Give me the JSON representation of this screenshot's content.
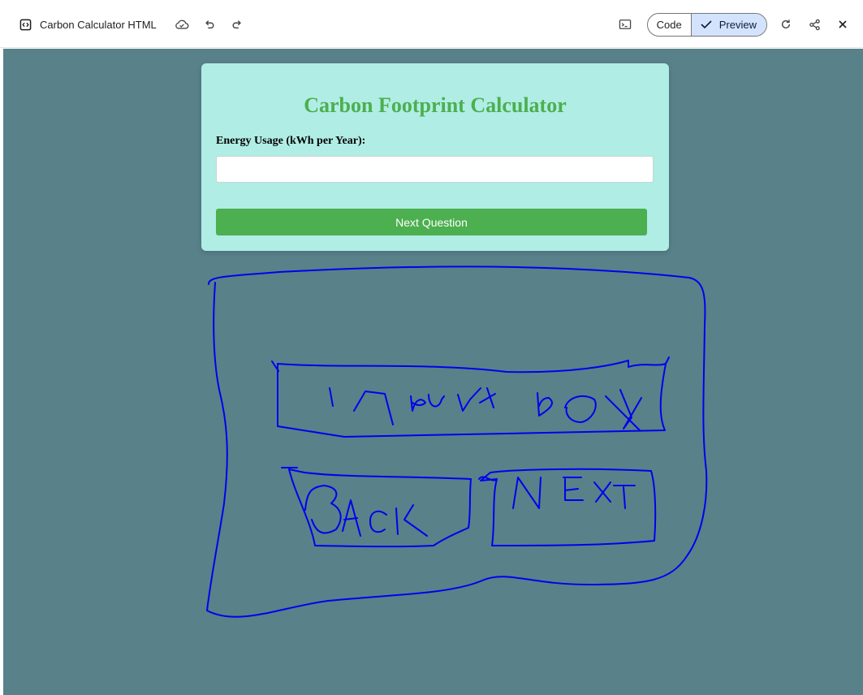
{
  "toolbar": {
    "title": "Carbon Calculator HTML",
    "code_label": "Code",
    "preview_label": "Preview"
  },
  "icons": [
    "code-file-icon",
    "cloud-saved-icon",
    "undo-icon",
    "redo-icon",
    "terminal-icon",
    "checkmark-icon",
    "refresh-icon",
    "share-icon",
    "close-icon"
  ],
  "app": {
    "heading": "Carbon Footprint Calculator",
    "field_label": "Energy Usage (kWh per Year):",
    "field_value": "",
    "next_button": "Next Question"
  },
  "colors": {
    "canvas_bg": "#58818a",
    "card_bg": "#b0ede4",
    "heading": "#4caf50",
    "button": "#4caf50",
    "sketch_ink": "#0000ee",
    "preview_active": "#d3e3fd"
  }
}
